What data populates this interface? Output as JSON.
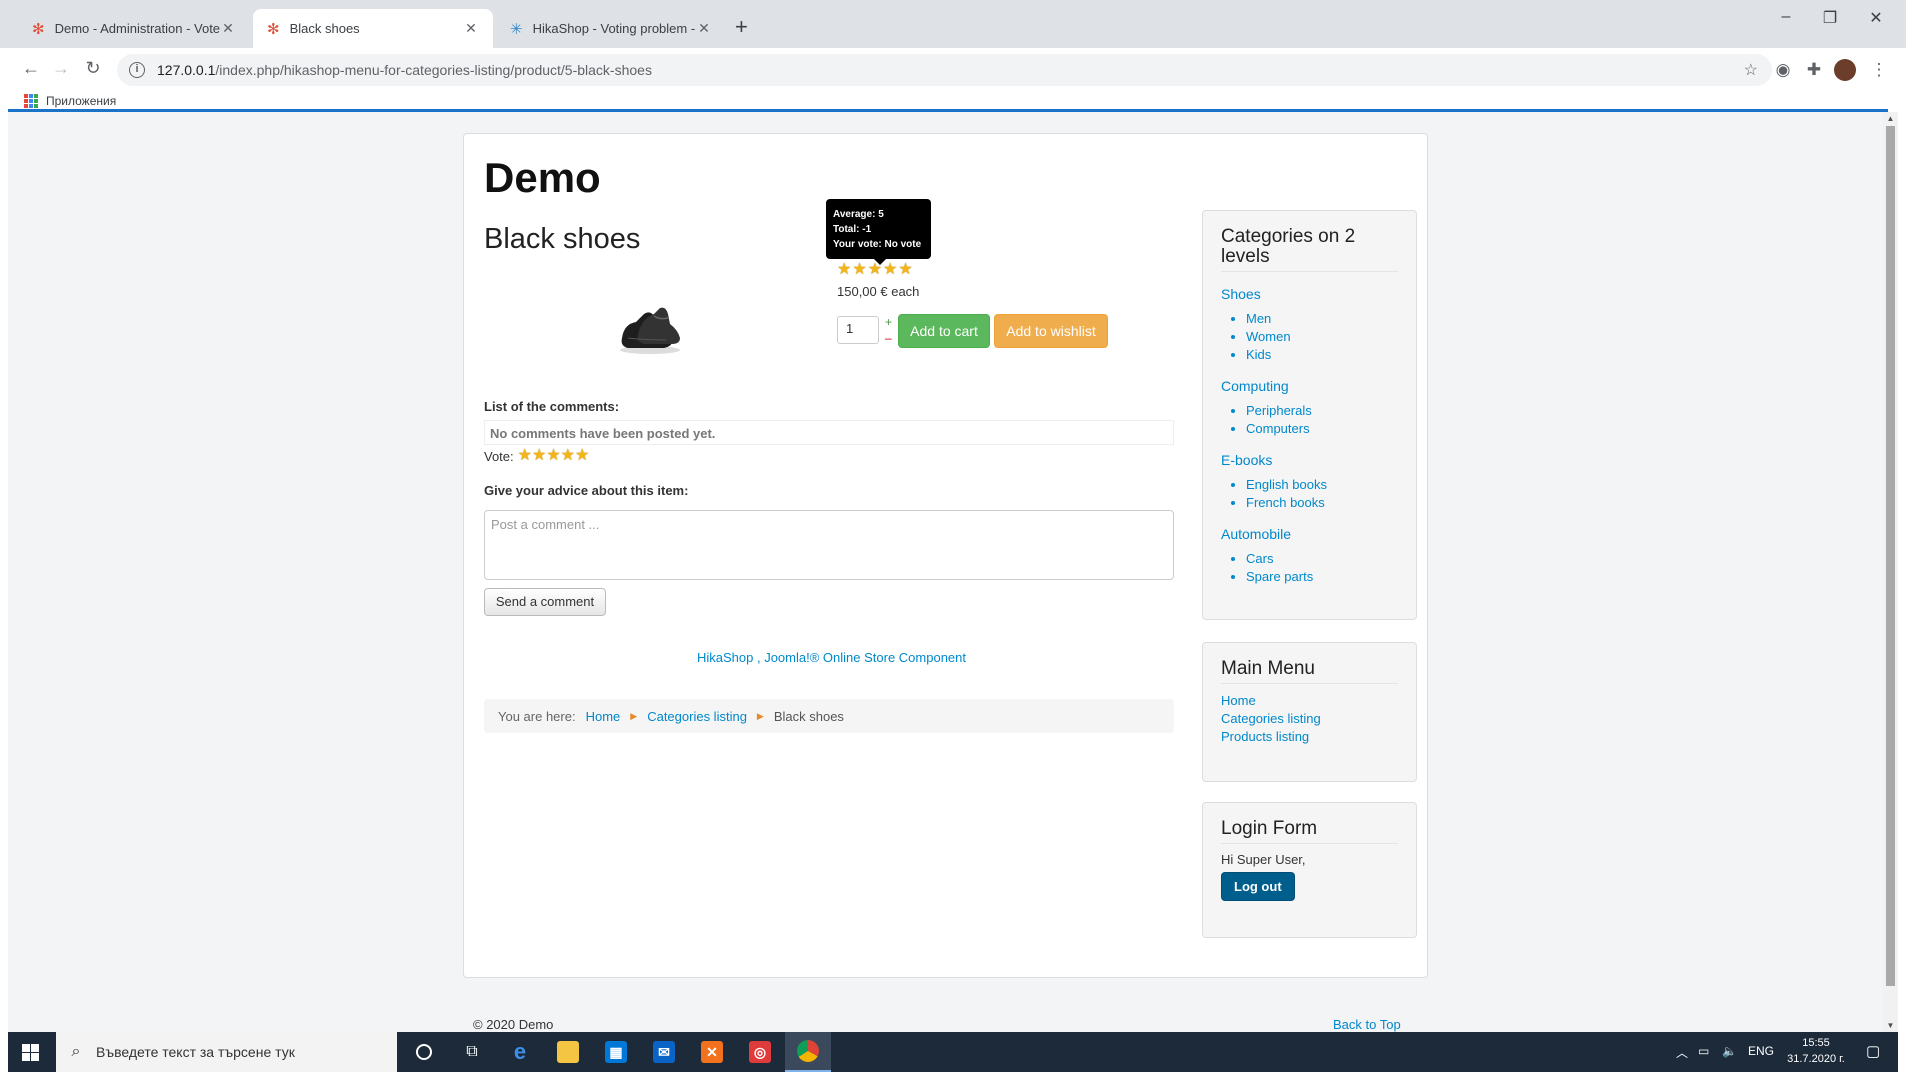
{
  "browser": {
    "tabs": [
      {
        "title": "Demo - Administration - Vote",
        "active": false
      },
      {
        "title": "Black shoes",
        "active": true
      },
      {
        "title": "HikaShop - Voting problem - Hik",
        "active": false
      }
    ],
    "new_tab": "+",
    "url_host": "127.0.0.1",
    "url_path": "/index.php/hikashop-menu-for-categories-listing/product/5-black-shoes",
    "bookmarks_label": "Приложения",
    "window_controls": {
      "minimize": "–",
      "restore": "❐",
      "close": "✕"
    }
  },
  "site": {
    "brand": "Demo",
    "product": {
      "title": "Black shoes",
      "rating": 5,
      "tooltip": {
        "average": "Average: 5",
        "total": "Total: -1",
        "your_vote": "Your vote: No vote"
      },
      "price": "150,00 € each",
      "quantity": "1",
      "qty_plus": "+",
      "qty_minus": "–",
      "add_to_cart": "Add to cart",
      "add_to_wishlist": "Add to wishlist"
    },
    "comments": {
      "title": "List of the comments:",
      "empty": "No comments have been posted yet.",
      "vote_label": "Vote:",
      "vote_stars": 5,
      "advice_title": "Give your advice about this item:",
      "placeholder": "Post a comment ...",
      "send_button": "Send a comment"
    },
    "powered_by": "HikaShop , Joomla!® Online Store Component",
    "breadcrumb": {
      "prefix": "You are here:",
      "items": [
        "Home",
        "Categories listing"
      ],
      "current": "Black shoes",
      "separator": "▶"
    },
    "categories_module": {
      "title": "Categories on 2 levels",
      "groups": [
        {
          "name": "Shoes",
          "items": [
            "Men",
            "Women",
            "Kids"
          ]
        },
        {
          "name": "Computing",
          "items": [
            "Peripherals",
            "Computers"
          ]
        },
        {
          "name": "E-books",
          "items": [
            "English books",
            "French books"
          ]
        },
        {
          "name": "Automobile",
          "items": [
            "Cars",
            "Spare parts"
          ]
        }
      ]
    },
    "main_menu": {
      "title": "Main Menu",
      "items": [
        "Home",
        "Categories listing",
        "Products listing"
      ]
    },
    "login_form": {
      "title": "Login Form",
      "greeting": "Hi Super User,",
      "logout": "Log out"
    },
    "footer": {
      "copyright": "© 2020 Demo",
      "back_to_top": "Back to Top"
    }
  },
  "taskbar": {
    "search_placeholder": "Въведете текст за търсене тук",
    "language": "ENG",
    "time": "15:55",
    "date": "31.7.2020 г."
  },
  "colors": {
    "star": "#f3b51a",
    "cart": "#5cb85c",
    "wishlist": "#f0ad4e",
    "link": "#0088cc",
    "logout": "#005e8d"
  }
}
